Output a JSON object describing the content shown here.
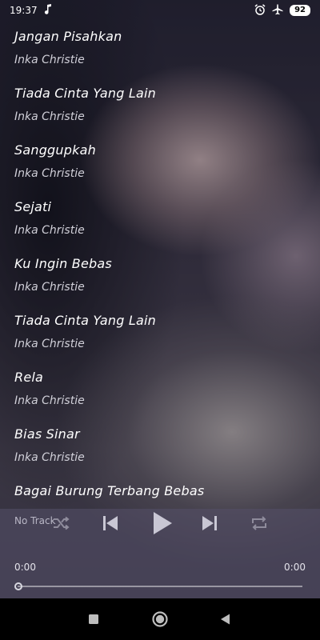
{
  "status_bar": {
    "time": "19:37",
    "battery": "92",
    "icons": [
      "music-note-icon",
      "alarm-icon",
      "airplane-icon",
      "battery-icon"
    ]
  },
  "tracks": [
    {
      "title": "Jangan Pisahkan",
      "artist": "Inka Christie"
    },
    {
      "title": "Tiada Cinta Yang Lain",
      "artist": "Inka Christie"
    },
    {
      "title": "Sanggupkah",
      "artist": "Inka Christie"
    },
    {
      "title": "Sejati",
      "artist": "Inka Christie"
    },
    {
      "title": "Ku Ingin Bebas",
      "artist": "Inka Christie"
    },
    {
      "title": "Tiada Cinta Yang Lain",
      "artist": "Inka Christie"
    },
    {
      "title": "Rela",
      "artist": "Inka Christie"
    },
    {
      "title": "Bias Sinar",
      "artist": "Inka Christie"
    },
    {
      "title": "Bagai Burung Terbang Bebas",
      "artist": ""
    }
  ],
  "player": {
    "now_playing": "No Track",
    "elapsed": "0:00",
    "duration": "0:00",
    "progress": 0
  },
  "nav": {
    "icons": [
      "recents-square-icon",
      "home-circle-icon",
      "back-triangle-icon"
    ]
  }
}
